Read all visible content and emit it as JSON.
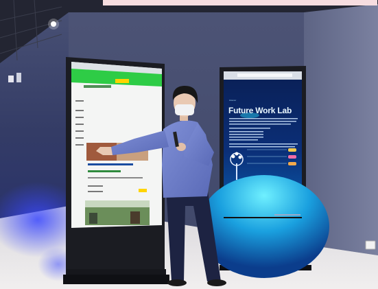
{
  "photo": {
    "right_screen": {
      "caption": "iHoover",
      "title": "Future Work Lab"
    },
    "colors": {
      "wall_left": "#2f3a62",
      "wall_right": "#6f7696",
      "floor": "#e8e6e6",
      "ceiling": "#232532",
      "kiosk_frame": "#1b1c22",
      "browser_green": "#2ecc46",
      "browser_yellow": "#ffd400",
      "fwl_screen": "#0a2d6a",
      "fwl_glow": "#27c7ee",
      "shirt": "#6d7ec9",
      "pants": "#1d2342"
    }
  }
}
